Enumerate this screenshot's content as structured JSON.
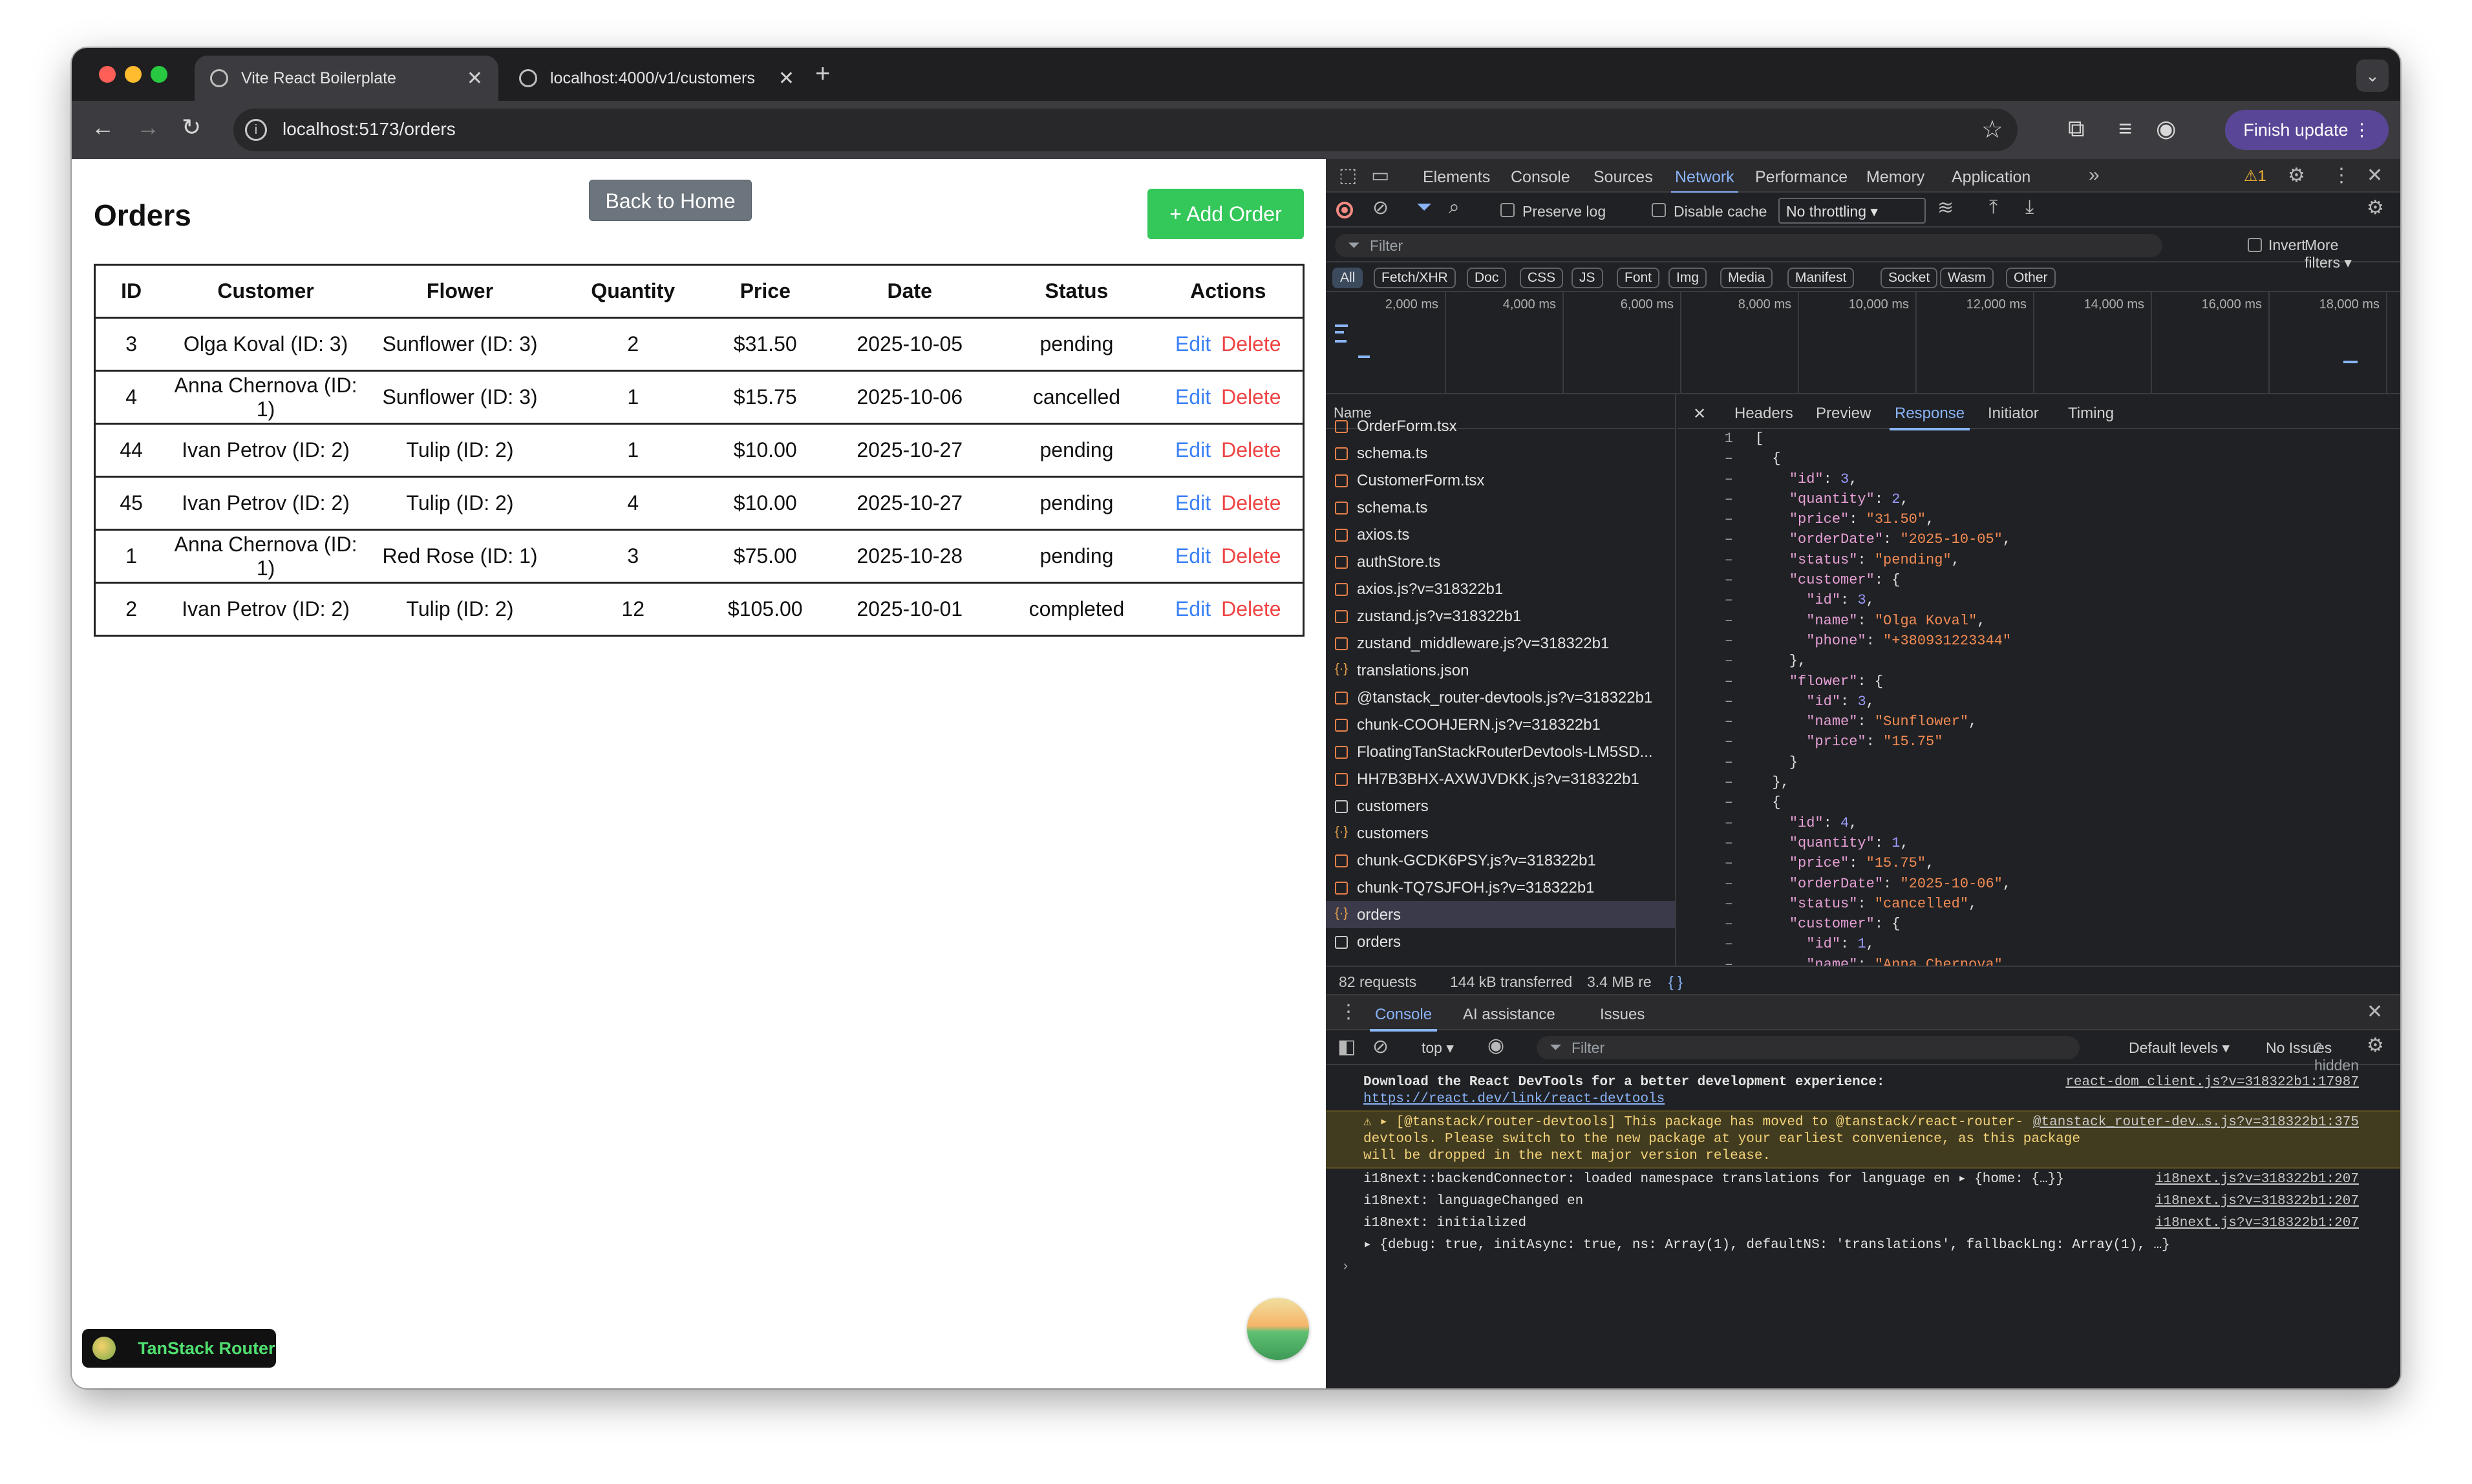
{
  "browser": {
    "tabs": [
      {
        "title": "Vite React Boilerplate",
        "active": true
      },
      {
        "title": "localhost:4000/v1/customers",
        "active": false
      }
    ],
    "new_tab": "+",
    "tab_search": "⌄",
    "url": "localhost:5173/orders",
    "finish_update": "Finish update",
    "icons": [
      "back-icon",
      "forward-icon",
      "reload-icon",
      "info-icon",
      "star-icon",
      "extensions-icon",
      "media-icon",
      "profile-icon",
      "menu-icon"
    ]
  },
  "page": {
    "title": "Orders",
    "back_button": "Back to Home",
    "add_button": "+ Add Order",
    "table": {
      "headers": [
        "ID",
        "Customer",
        "Flower",
        "Quantity",
        "Price",
        "Date",
        "Status",
        "Actions"
      ],
      "rows": [
        {
          "id": "3",
          "customer": "Olga Koval (ID: 3)",
          "flower": "Sunflower (ID: 3)",
          "quantity": "2",
          "price": "$31.50",
          "date": "2025-10-05",
          "status": "pending"
        },
        {
          "id": "4",
          "customer": "Anna Chernova (ID: 1)",
          "flower": "Sunflower (ID: 3)",
          "quantity": "1",
          "price": "$15.75",
          "date": "2025-10-06",
          "status": "cancelled"
        },
        {
          "id": "44",
          "customer": "Ivan Petrov (ID: 2)",
          "flower": "Tulip (ID: 2)",
          "quantity": "1",
          "price": "$10.00",
          "date": "2025-10-27",
          "status": "pending"
        },
        {
          "id": "45",
          "customer": "Ivan Petrov (ID: 2)",
          "flower": "Tulip (ID: 2)",
          "quantity": "4",
          "price": "$10.00",
          "date": "2025-10-27",
          "status": "pending"
        },
        {
          "id": "1",
          "customer": "Anna Chernova (ID: 1)",
          "flower": "Red Rose (ID: 1)",
          "quantity": "3",
          "price": "$75.00",
          "date": "2025-10-28",
          "status": "pending"
        },
        {
          "id": "2",
          "customer": "Ivan Petrov (ID: 2)",
          "flower": "Tulip (ID: 2)",
          "quantity": "12",
          "price": "$105.00",
          "date": "2025-10-01",
          "status": "completed"
        }
      ],
      "edit_label": "Edit",
      "delete_label": "Delete"
    },
    "router_badge": "TanStack Router"
  },
  "devtools": {
    "panels": [
      "Elements",
      "Console",
      "Sources",
      "Network",
      "Performance",
      "Memory",
      "Application"
    ],
    "active_panel": "Network",
    "warning_count": "1",
    "network_toolbar": {
      "preserve_log": "Preserve log",
      "disable_cache": "Disable cache",
      "throttling": "No throttling"
    },
    "filter": {
      "placeholder": "Filter",
      "invert": "Invert",
      "more_filters": "More filters"
    },
    "types": [
      "All",
      "Fetch/XHR",
      "Doc",
      "CSS",
      "JS",
      "Font",
      "Img",
      "Media",
      "Manifest",
      "Socket",
      "Wasm",
      "Other"
    ],
    "timeline_ticks": [
      "2,000 ms",
      "4,000 ms",
      "6,000 ms",
      "8,000 ms",
      "10,000 ms",
      "12,000 ms",
      "14,000 ms",
      "16,000 ms",
      "18,000 ms"
    ],
    "requests_header": "Name",
    "requests": [
      {
        "name": "OrderForm.tsx",
        "kind": "script"
      },
      {
        "name": "schema.ts",
        "kind": "script"
      },
      {
        "name": "CustomerForm.tsx",
        "kind": "script"
      },
      {
        "name": "schema.ts",
        "kind": "script"
      },
      {
        "name": "axios.ts",
        "kind": "script"
      },
      {
        "name": "authStore.ts",
        "kind": "script"
      },
      {
        "name": "axios.js?v=318322b1",
        "kind": "script"
      },
      {
        "name": "zustand.js?v=318322b1",
        "kind": "script"
      },
      {
        "name": "zustand_middleware.js?v=318322b1",
        "kind": "script"
      },
      {
        "name": "translations.json",
        "kind": "json"
      },
      {
        "name": "@tanstack_router-devtools.js?v=318322b1",
        "kind": "script"
      },
      {
        "name": "chunk-COOHJERN.js?v=318322b1",
        "kind": "script"
      },
      {
        "name": "FloatingTanStackRouterDevtools-LM5SD...",
        "kind": "script"
      },
      {
        "name": "HH7B3BHX-AXWJVDKK.js?v=318322b1",
        "kind": "script"
      },
      {
        "name": "customers",
        "kind": "doc"
      },
      {
        "name": "customers",
        "kind": "json"
      },
      {
        "name": "chunk-GCDK6PSY.js?v=318322b1",
        "kind": "script"
      },
      {
        "name": "chunk-TQ7SJFOH.js?v=318322b1",
        "kind": "script"
      },
      {
        "name": "orders",
        "kind": "json",
        "selected": true
      },
      {
        "name": "orders",
        "kind": "doc"
      }
    ],
    "detail_tabs": [
      "Headers",
      "Preview",
      "Response",
      "Initiator",
      "Timing"
    ],
    "active_detail_tab": "Response",
    "response_lines": [
      {
        "ln": "1",
        "text": "["
      },
      {
        "ln": "–",
        "text": "  {"
      },
      {
        "ln": "–",
        "text": "    \"id\": 3,"
      },
      {
        "ln": "–",
        "text": "    \"quantity\": 2,"
      },
      {
        "ln": "–",
        "text": "    \"price\": \"31.50\","
      },
      {
        "ln": "–",
        "text": "    \"orderDate\": \"2025-10-05\","
      },
      {
        "ln": "–",
        "text": "    \"status\": \"pending\","
      },
      {
        "ln": "–",
        "text": "    \"customer\": {"
      },
      {
        "ln": "–",
        "text": "      \"id\": 3,"
      },
      {
        "ln": "–",
        "text": "      \"name\": \"Olga Koval\","
      },
      {
        "ln": "–",
        "text": "      \"phone\": \"+380931223344\""
      },
      {
        "ln": "–",
        "text": "    },"
      },
      {
        "ln": "–",
        "text": "    \"flower\": {"
      },
      {
        "ln": "–",
        "text": "      \"id\": 3,"
      },
      {
        "ln": "–",
        "text": "      \"name\": \"Sunflower\","
      },
      {
        "ln": "–",
        "text": "      \"price\": \"15.75\""
      },
      {
        "ln": "–",
        "text": "    }"
      },
      {
        "ln": "–",
        "text": "  },"
      },
      {
        "ln": "–",
        "text": "  {"
      },
      {
        "ln": "–",
        "text": "    \"id\": 4,"
      },
      {
        "ln": "–",
        "text": "    \"quantity\": 1,"
      },
      {
        "ln": "–",
        "text": "    \"price\": \"15.75\","
      },
      {
        "ln": "–",
        "text": "    \"orderDate\": \"2025-10-06\","
      },
      {
        "ln": "–",
        "text": "    \"status\": \"cancelled\","
      },
      {
        "ln": "–",
        "text": "    \"customer\": {"
      },
      {
        "ln": "–",
        "text": "      \"id\": 1,"
      },
      {
        "ln": "–",
        "text": "      \"name\": \"Anna Chernova\""
      }
    ],
    "status": {
      "requests": "82 requests",
      "transferred": "144 kB transferred",
      "resources": "3.4 MB re",
      "format": "{ }"
    },
    "drawer": {
      "tabs": [
        "Console",
        "AI assistance",
        "Issues"
      ],
      "active_tab": "Console",
      "context": "top",
      "filter_placeholder": "Filter",
      "levels": "Default levels",
      "issues": "No Issues",
      "hidden": "2 hidden",
      "messages": [
        {
          "level": "info",
          "source": "react-dom_client.js?v=318322b1:17987",
          "text_bold": "Download the React DevTools for a better development experience: ",
          "link": "https://react.dev/link/react-devtools"
        },
        {
          "level": "warn",
          "source": "@tanstack_router-dev…s.js?v=318322b1:375",
          "text": "▸ [@tanstack/router-devtools] This package has moved to @tanstack/react-router-devtools. Please switch to the new package at your earliest convenience, as this package will be dropped in the next major version release."
        },
        {
          "level": "info",
          "source": "i18next.js?v=318322b1:207",
          "text": "i18next::backendConnector: loaded namespace translations for language en  ▸ {home: {…}}"
        },
        {
          "level": "info",
          "source": "i18next.js?v=318322b1:207",
          "text": "i18next: languageChanged en"
        },
        {
          "level": "info",
          "source": "i18next.js?v=318322b1:207",
          "text": "i18next: initialized"
        },
        {
          "level": "info",
          "source": "",
          "text": "  ▸ {debug: true, initAsync: true, ns: Array(1), defaultNS: 'translations', fallbackLng: Array(1), …}"
        }
      ],
      "prompt": "›"
    }
  },
  "colors": {
    "add_button": "#34c759",
    "back_button": "#6c757d",
    "edit_link": "#3b82f6",
    "delete_link": "#ef4444",
    "devtools_accent": "#8ab4f8",
    "finish_update": "#5a4696"
  }
}
